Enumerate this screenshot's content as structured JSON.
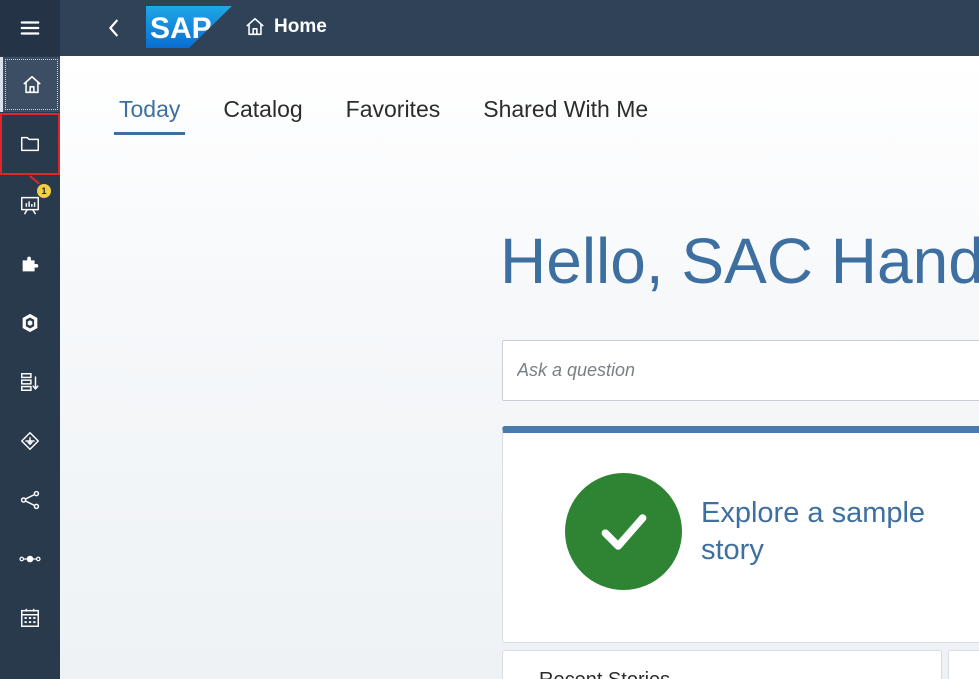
{
  "header": {
    "logo_text": "SAP",
    "breadcrumb": "Home"
  },
  "sidenav": {
    "items": [
      {
        "icon": "menu-icon"
      },
      {
        "icon": "home-icon",
        "selected": true
      },
      {
        "icon": "folder-icon",
        "highlighted": true
      },
      {
        "icon": "stories-icon",
        "badge": "1"
      },
      {
        "icon": "analytic-app-icon"
      },
      {
        "icon": "modeler-icon"
      },
      {
        "icon": "data-import-icon"
      },
      {
        "icon": "predictive-icon"
      },
      {
        "icon": "connections-icon"
      },
      {
        "icon": "data-flow-icon"
      },
      {
        "icon": "calendar-icon"
      }
    ]
  },
  "tabs": [
    "Today",
    "Catalog",
    "Favorites",
    "Shared With Me"
  ],
  "greeting": "Hello, SAC Hand",
  "search": {
    "placeholder": "Ask a question"
  },
  "sample_card": {
    "text": "Explore a sample story"
  },
  "bottom_card": {
    "title": "Recent Stories"
  },
  "colors": {
    "nav_bg": "#2a3a4d",
    "shellbar_bg": "#2f4258",
    "accent": "#3d6fa0",
    "success": "#2f8434",
    "highlight": "#e0262b",
    "badge": "#f3cf46"
  }
}
